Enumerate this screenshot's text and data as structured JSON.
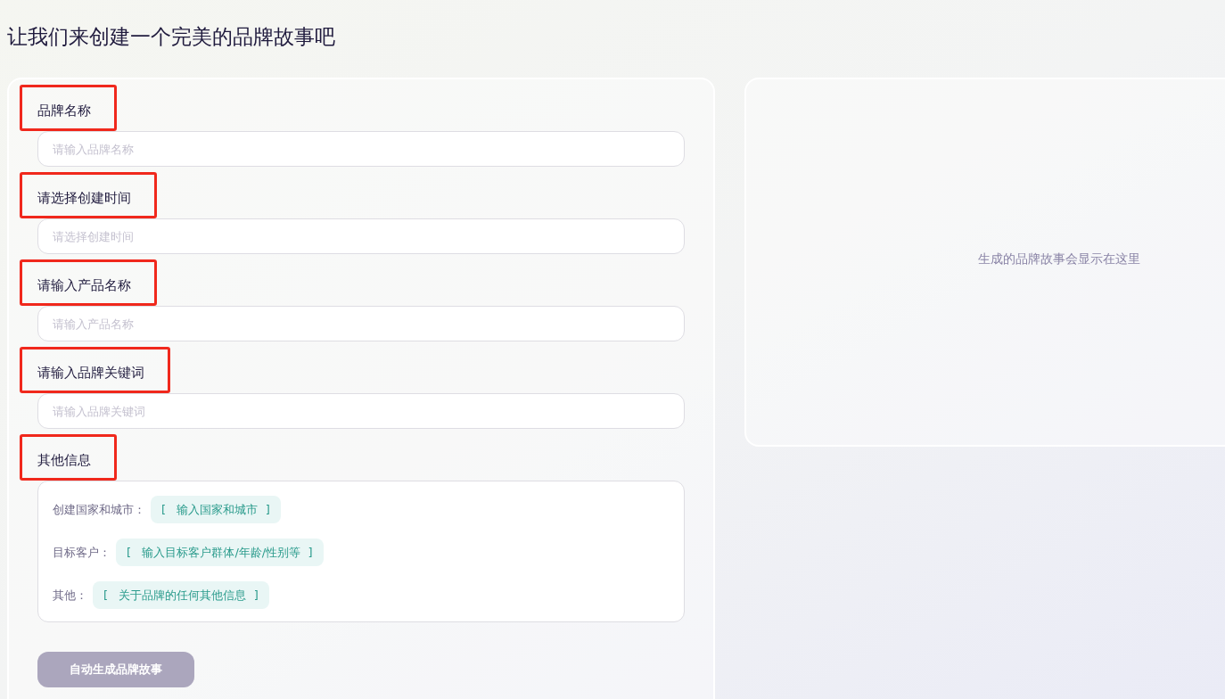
{
  "page_title": "让我们来创建一个完美的品牌故事吧",
  "fields": [
    {
      "label": "品牌名称",
      "placeholder": "请输入品牌名称",
      "highlighted": true
    },
    {
      "label": "请选择创建时间",
      "placeholder": "请选择创建时间",
      "highlighted": true
    },
    {
      "label": "请输入产品名称",
      "placeholder": "请输入产品名称",
      "highlighted": true
    },
    {
      "label": "请输入品牌关键词",
      "placeholder": "请输入品牌关键词",
      "highlighted": true
    }
  ],
  "other_info": {
    "label": "其他信息",
    "highlighted": true,
    "rows": [
      {
        "label": "创建国家和城市：",
        "chip": "[   输入国家和城市  ]"
      },
      {
        "label": "目标客户：",
        "chip": "[   输入目标客户群体/年龄/性别等  ]"
      },
      {
        "label": "其他：",
        "chip": "[   关于品牌的任何其他信息  ]"
      }
    ]
  },
  "generate_button": {
    "label": "自动生成品牌故事",
    "disabled": true
  },
  "output_panel": {
    "empty_message": "生成的品牌故事会显示在这里"
  }
}
